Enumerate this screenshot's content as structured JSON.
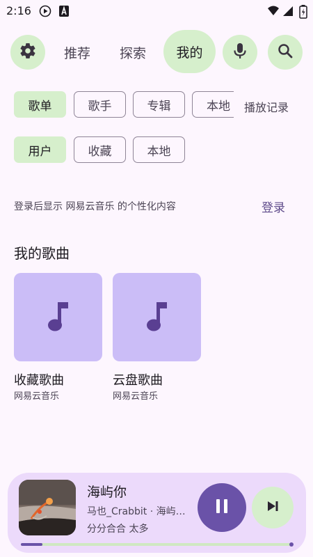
{
  "status": {
    "time": "2:16"
  },
  "nav": {
    "settings_icon": "gear-icon",
    "tab_recommend": "推荐",
    "tab_explore": "探索",
    "tab_mine": "我的",
    "mic_icon": "mic-icon",
    "search_icon": "search-icon"
  },
  "filters_row1": {
    "playlist": "歌单",
    "artist": "歌手",
    "album": "专辑",
    "local": "本地",
    "history": "播放记录"
  },
  "filters_row2": {
    "user": "用户",
    "favorites": "收藏",
    "local": "本地"
  },
  "login_hint": "登录后显示 网易云音乐 的个性化内容",
  "login_button": "登录",
  "my_songs": {
    "title": "我的歌曲",
    "cards": [
      {
        "title": "收藏歌曲",
        "subtitle": "网易云音乐",
        "icon": "music-note-icon"
      },
      {
        "title": "云盘歌曲",
        "subtitle": "网易云音乐",
        "icon": "music-note-icon"
      }
    ]
  },
  "player": {
    "title": "海屿你",
    "artist": "马也_Crabbit · 海屿…",
    "lyric": "分分合合 太多",
    "progress": 0.08,
    "play_icon": "pause-icon",
    "next_icon": "skip-next-icon"
  },
  "colors": {
    "background": "#fdf6fe",
    "selected": "#d6efcc",
    "accent": "#6a52a8",
    "card": "#cbbdf7"
  }
}
